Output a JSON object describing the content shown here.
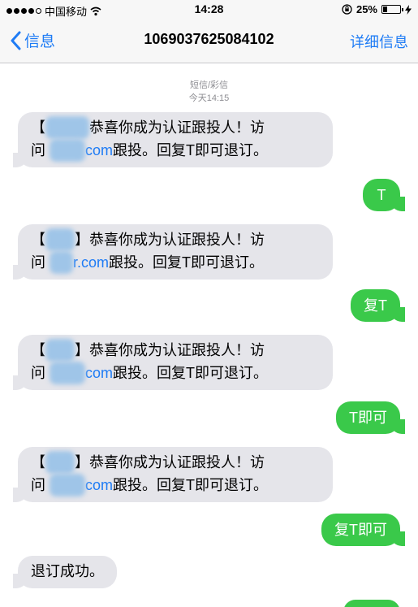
{
  "status_bar": {
    "carrier": "中国移动",
    "time": "14:28",
    "battery_pct": "25%",
    "battery_level": 0.25
  },
  "nav": {
    "back_label": "信息",
    "title": "1069037625084102",
    "detail_label": "详细信息"
  },
  "thread": {
    "channel": "短信/彩信",
    "timestamp": "今天14:15"
  },
  "messages": [
    {
      "direction": "incoming",
      "prefix": "【",
      "line1_rest": "恭喜你成为认证跟投人！访",
      "line2_start": "问",
      "link_suffix": "com",
      "line2_rest": "跟投。回复T即可退订。"
    },
    {
      "direction": "outgoing",
      "text": "T"
    },
    {
      "direction": "incoming",
      "prefix": "【",
      "line1_rest": "】恭喜你成为认证跟投人！访",
      "line2_start": "问",
      "link_suffix": "r.com",
      "line2_rest": "跟投。回复T即可退订。"
    },
    {
      "direction": "outgoing",
      "text": "复T"
    },
    {
      "direction": "incoming",
      "prefix": "【",
      "line1_rest": "】恭喜你成为认证跟投人！访",
      "line2_start": "问",
      "link_suffix": "com",
      "line2_rest": "跟投。回复T即可退订。"
    },
    {
      "direction": "outgoing",
      "text": "T即可"
    },
    {
      "direction": "incoming",
      "prefix": "【",
      "line1_rest": "】恭喜你成为认证跟投人！访",
      "line2_start": "问",
      "link_suffix": "com",
      "line2_rest": "跟投。回复T即可退订。"
    },
    {
      "direction": "outgoing",
      "text": "复T即可"
    },
    {
      "direction": "incoming",
      "text": "退订成功。"
    }
  ]
}
